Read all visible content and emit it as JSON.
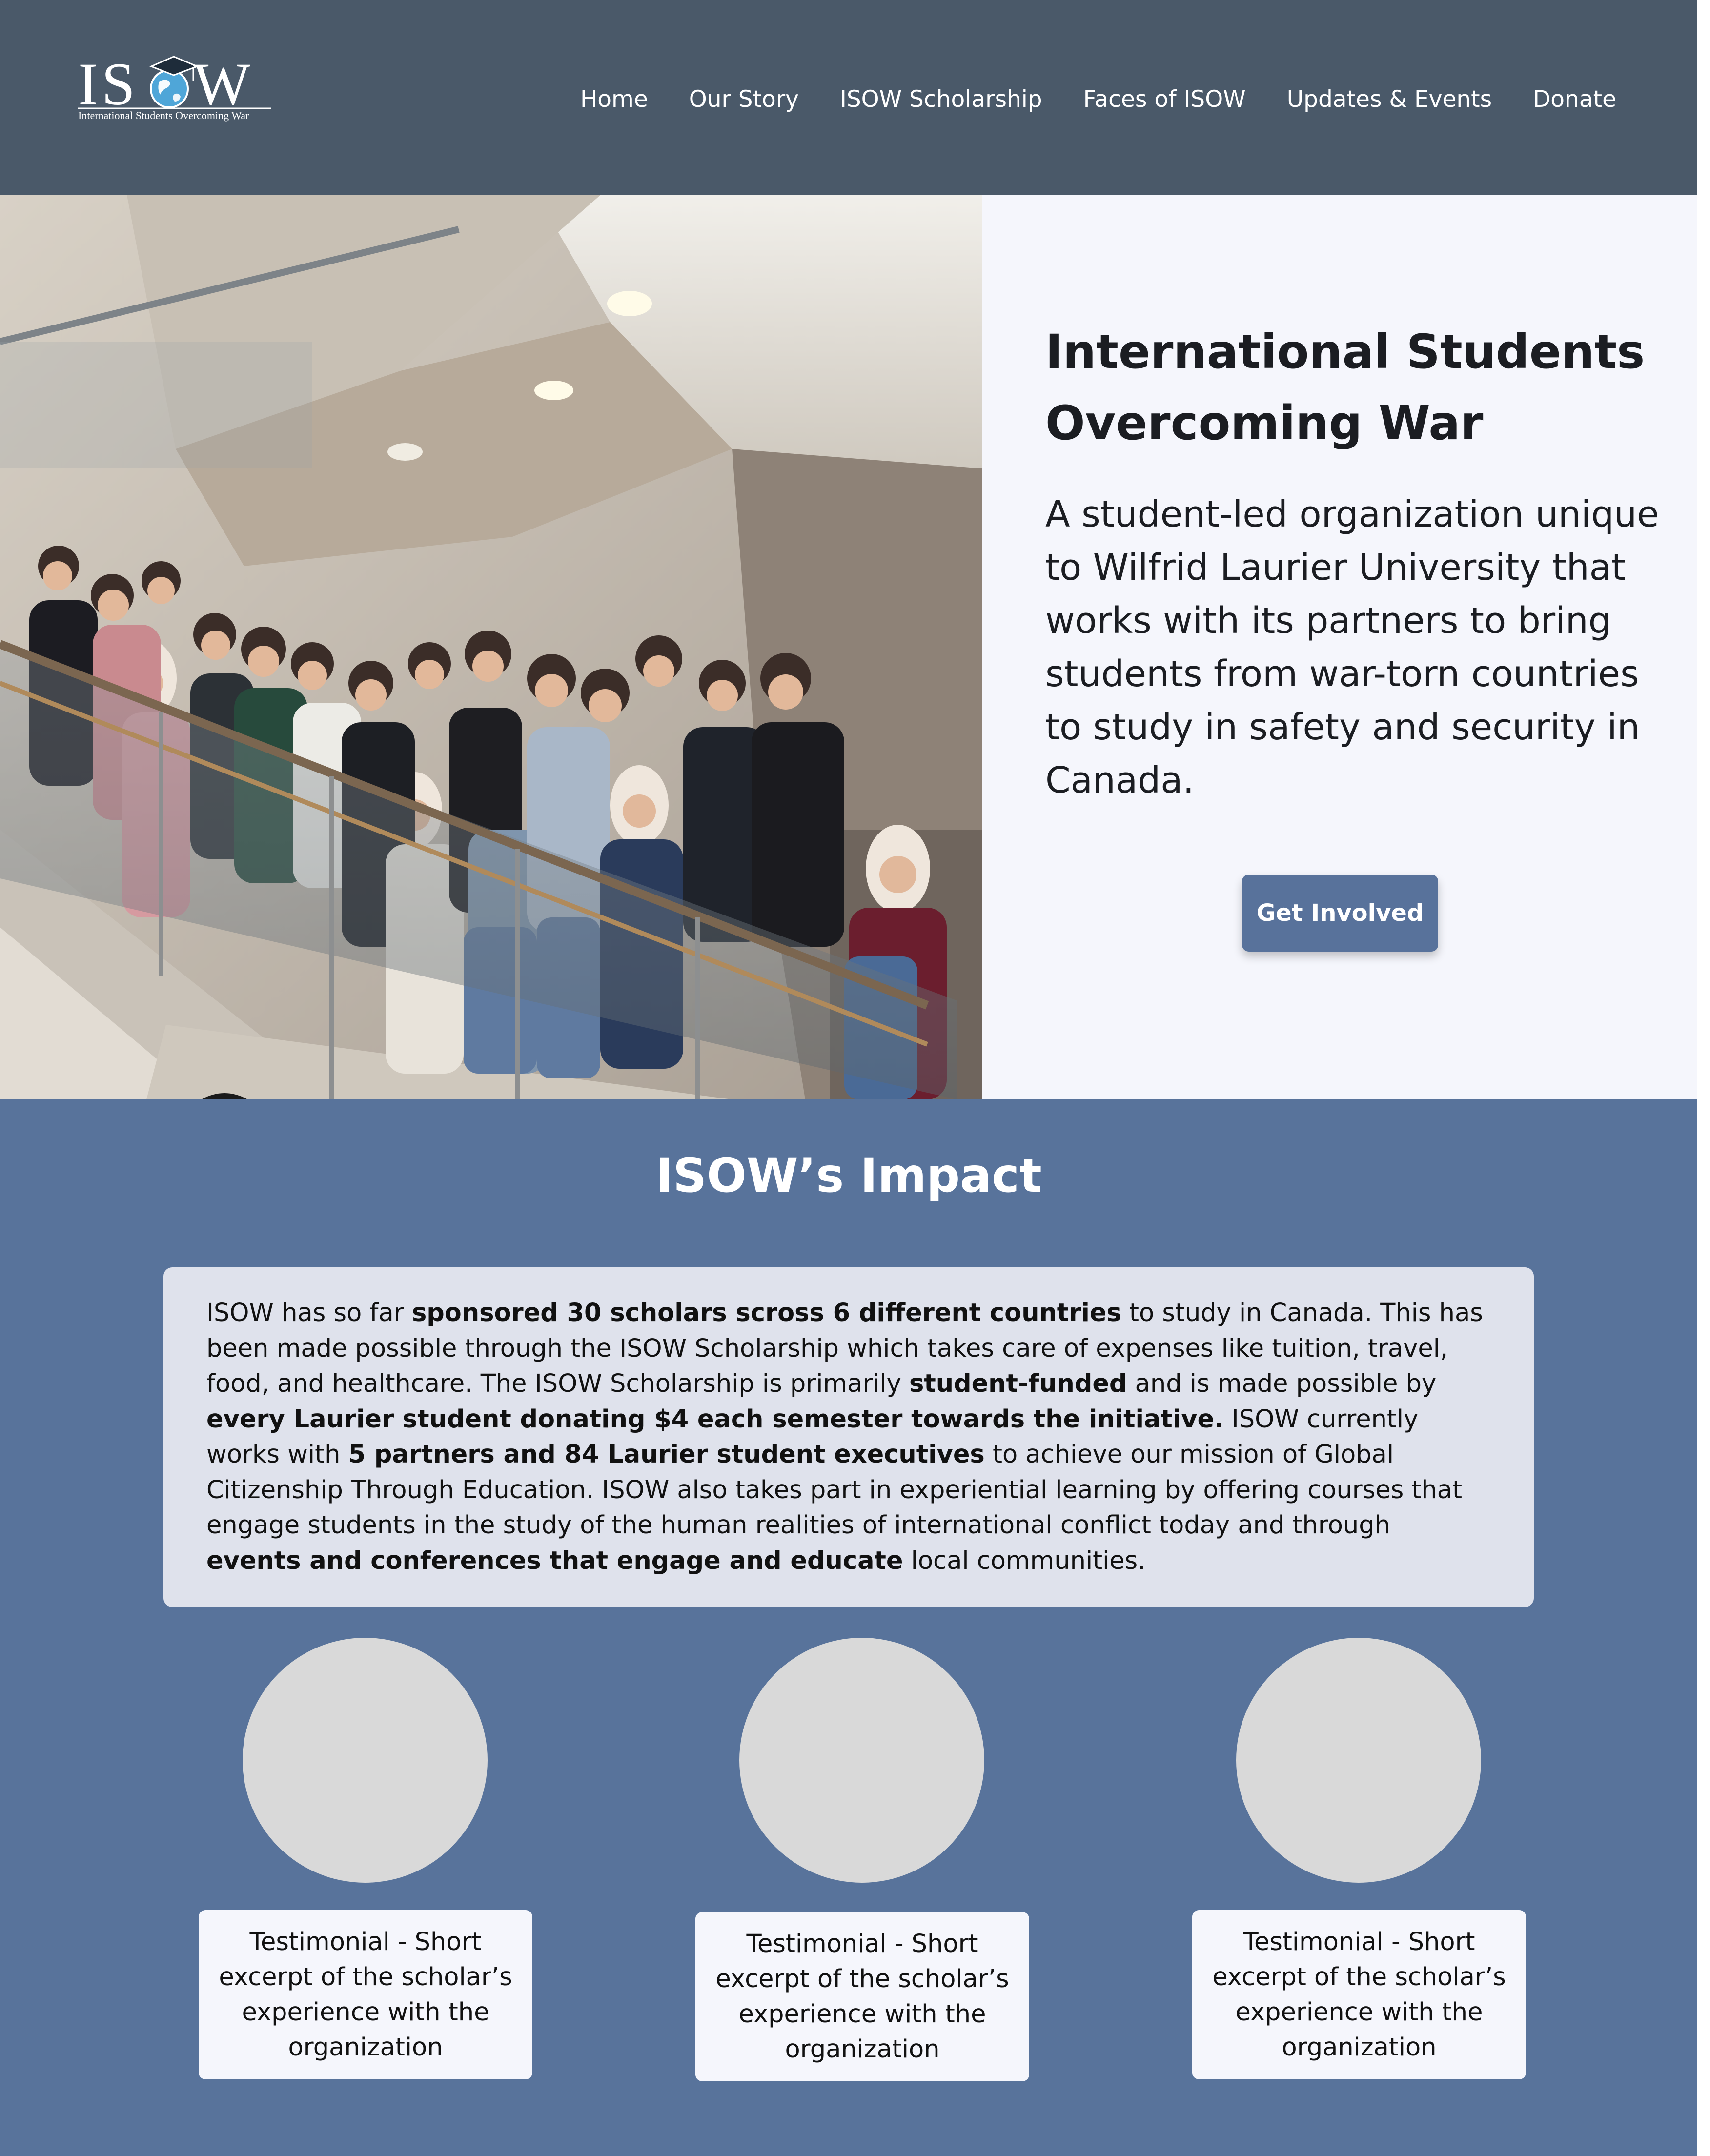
{
  "header": {
    "logo_text": "ISOW",
    "logo_tagline": "International Students Overcoming War",
    "nav": [
      "Home",
      "Our Story",
      "ISOW Scholarship",
      "Faces of ISOW",
      "Updates & Events",
      "Donate"
    ]
  },
  "hero": {
    "photo_alt": "Group photo of ISOW members on a staircase",
    "title": "International Students Overcoming War",
    "description": "A student-led organization unique to Wilfrid Laurier University that works with its partners to bring students from war-torn countries to study in safety and security in Canada.",
    "cta_label": "Get Involved"
  },
  "impact": {
    "title": "ISOW’s Impact",
    "paragraph_parts": [
      {
        "text": "ISOW has so far ",
        "bold": false
      },
      {
        "text": "sponsored 30 scholars scross 6 different countries",
        "bold": true
      },
      {
        "text": " to study in Canada. This has been made possible through the ISOW Scholarship which takes care of expenses like tuition, travel, food, and healthcare. The ISOW Scholarship is primarily ",
        "bold": false
      },
      {
        "text": "student-funded",
        "bold": true
      },
      {
        "text": " and is made possible by ",
        "bold": false
      },
      {
        "text": "every Laurier student donating $4 each semester towards the initiative.",
        "bold": true
      },
      {
        "text": " ISOW currently works with ",
        "bold": false
      },
      {
        "text": "5 partners and 84 Laurier student executives",
        "bold": true
      },
      {
        "text": " to achieve our mission of Global Citizenship Through Education. ISOW also takes part in experiential learning by offering courses that engage students in the study of the human realities of international conflict today and through ",
        "bold": false
      },
      {
        "text": "events and conferences that engage and educate",
        "bold": true
      },
      {
        "text": " local communities.",
        "bold": false
      }
    ],
    "testimonials": [
      {
        "text": "Testimonial - Short excerpt of the scholar’s experience with the organization"
      },
      {
        "text": "Testimonial - Short excerpt of the scholar’s experience with the organization"
      },
      {
        "text": "Testimonial - Short excerpt of the scholar’s experience with the organization"
      }
    ]
  },
  "colors": {
    "header_bg": "#4a5969",
    "hero_panel_bg": "#f5f6fc",
    "accent": "#58729b",
    "impact_bg": "#58739b",
    "impact_card_bg": "#dfe2ec",
    "avatar_placeholder": "#d9d9d9"
  }
}
